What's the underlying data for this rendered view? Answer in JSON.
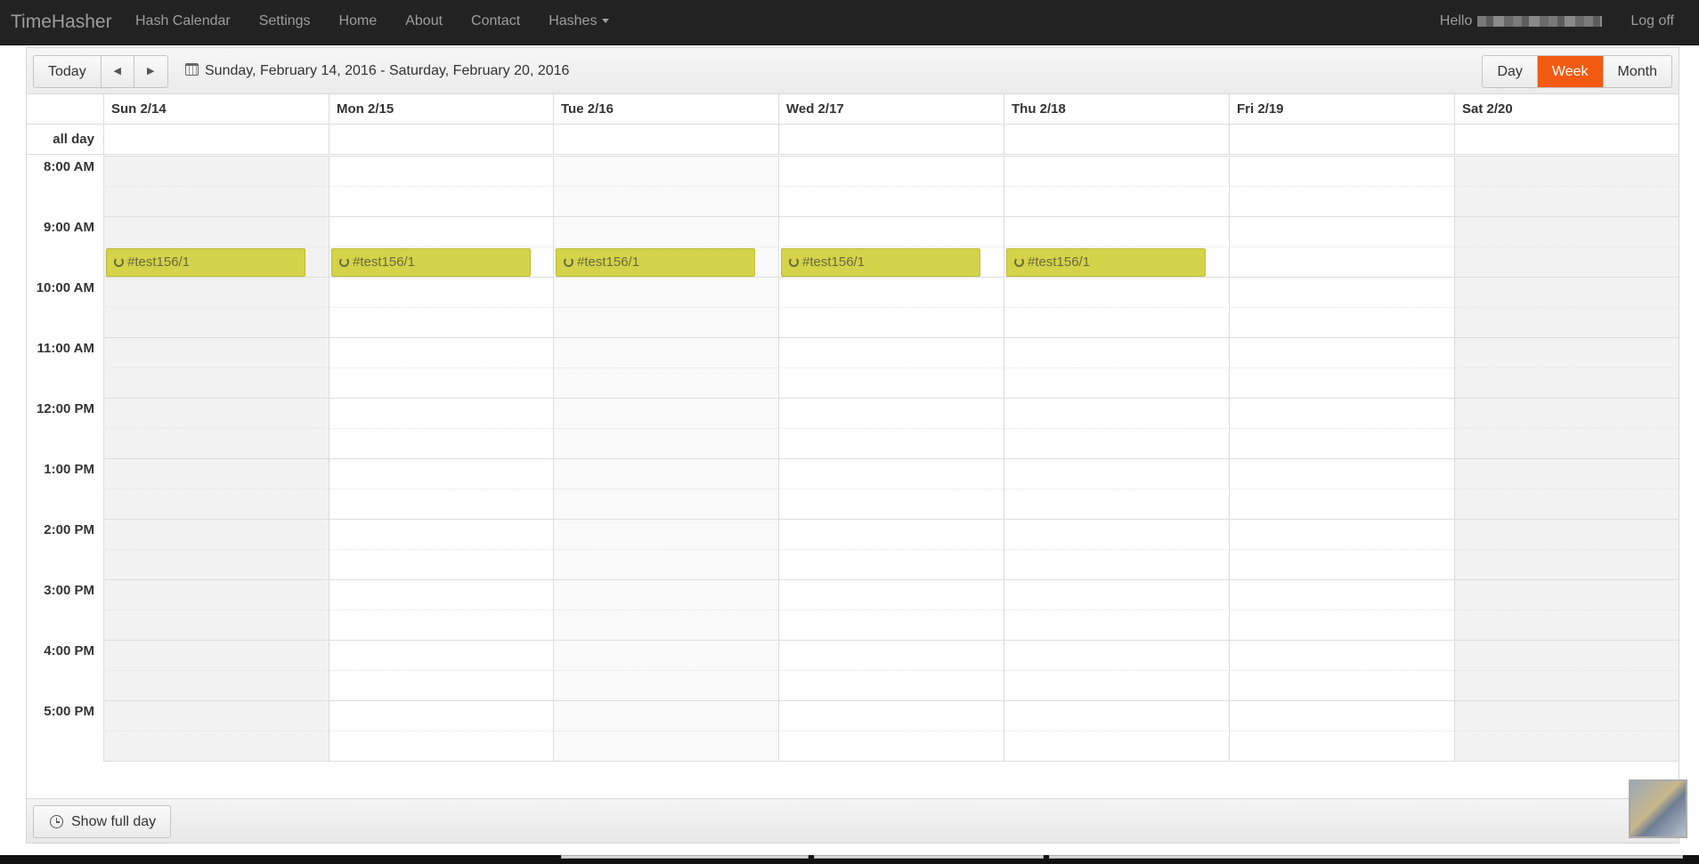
{
  "navbar": {
    "brand": "TimeHasher",
    "items": [
      {
        "label": "Hash Calendar"
      },
      {
        "label": "Settings"
      },
      {
        "label": "Home"
      },
      {
        "label": "About"
      },
      {
        "label": "Contact"
      },
      {
        "label": "Hashes"
      }
    ],
    "hello": "Hello",
    "logoff": "Log off"
  },
  "toolbar": {
    "today": "Today",
    "prev": "◀",
    "next": "▶",
    "range": "Sunday, February 14, 2016 - Saturday, February 20, 2016",
    "views": [
      {
        "label": "Day",
        "active": false
      },
      {
        "label": "Week",
        "active": true
      },
      {
        "label": "Month",
        "active": false
      }
    ],
    "active_color": "#f35a12"
  },
  "calendar": {
    "all_day_label": "all day",
    "days": [
      {
        "label": "Sun 2/14"
      },
      {
        "label": "Mon 2/15"
      },
      {
        "label": "Tue 2/16"
      },
      {
        "label": "Wed 2/17"
      },
      {
        "label": "Thu 2/18"
      },
      {
        "label": "Fri 2/19"
      },
      {
        "label": "Sat 2/20"
      }
    ],
    "times": [
      "8:00 AM",
      "9:00 AM",
      "10:00 AM",
      "11:00 AM",
      "12:00 PM",
      "1:00 PM",
      "2:00 PM",
      "3:00 PM",
      "4:00 PM",
      "5:00 PM"
    ],
    "events": [
      {
        "day": 0,
        "start": "9:30 AM",
        "title": "#test156/1"
      },
      {
        "day": 1,
        "start": "9:30 AM",
        "title": "#test156/1"
      },
      {
        "day": 2,
        "start": "9:30 AM",
        "title": "#test156/1"
      },
      {
        "day": 3,
        "start": "9:30 AM",
        "title": "#test156/1"
      },
      {
        "day": 4,
        "start": "9:30 AM",
        "title": "#test156/1"
      }
    ],
    "event_color": "#d4d34a"
  },
  "footer": {
    "show_full_day": "Show full day"
  }
}
